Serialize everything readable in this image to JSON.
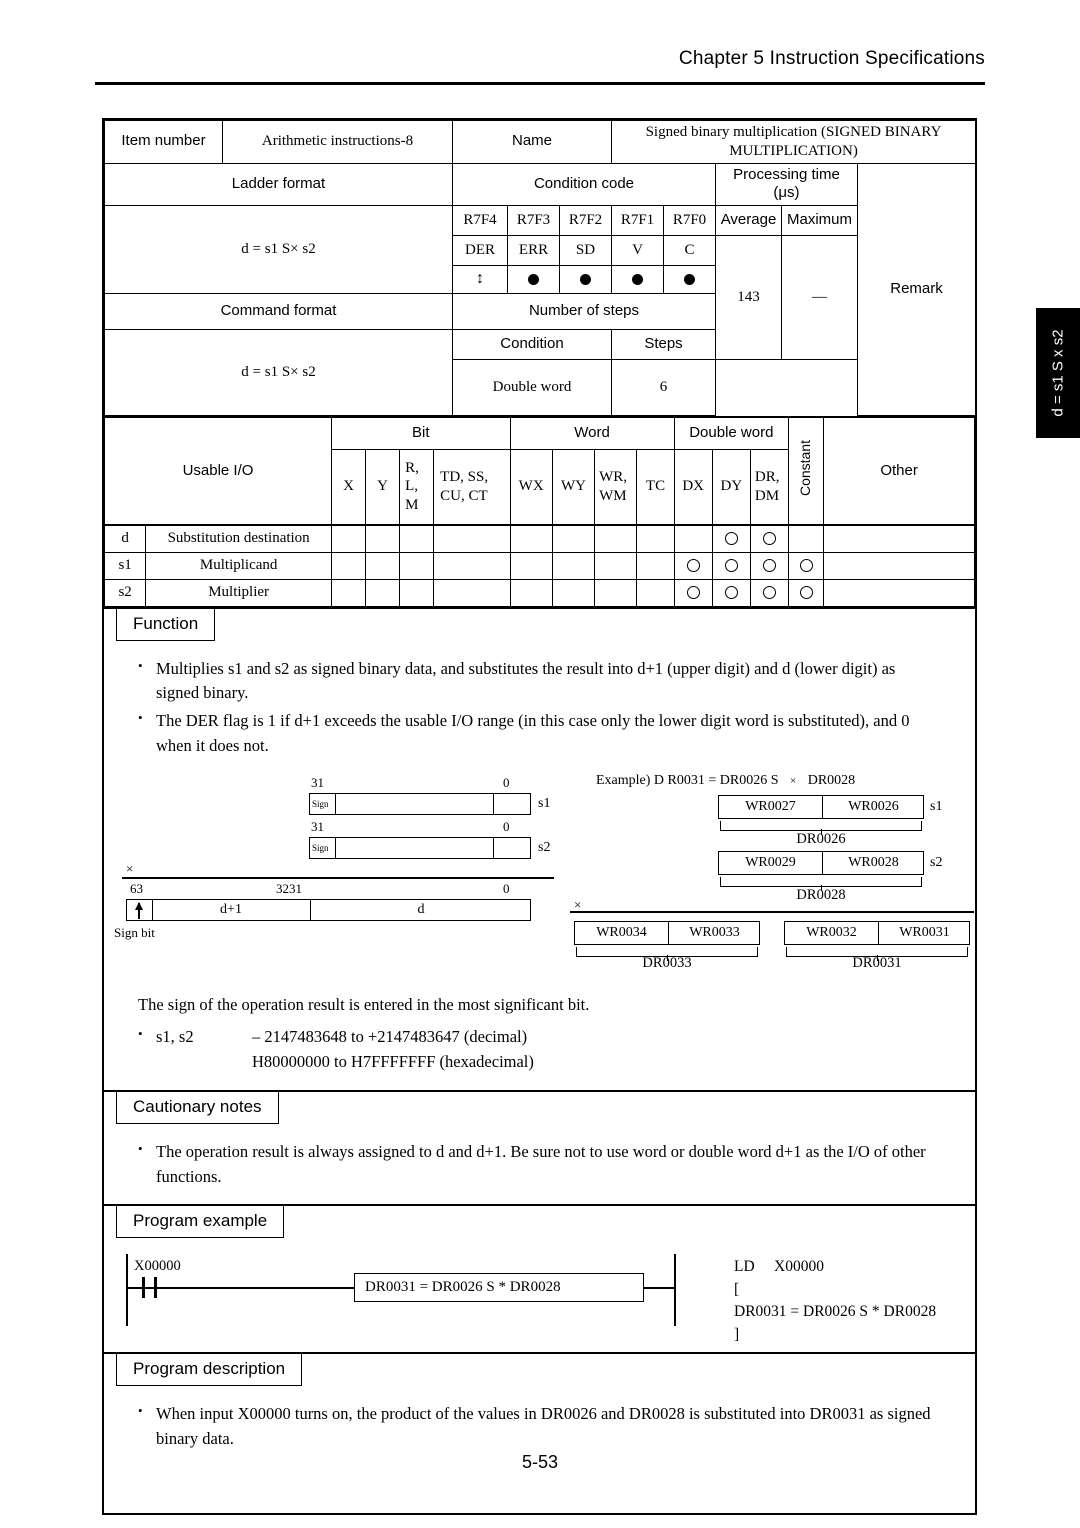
{
  "header": {
    "chapter": "Chapter 5  Instruction Specifications"
  },
  "side_tab": {
    "label": "d = s1 S x s2"
  },
  "footer": {
    "page_number": "5-53"
  },
  "spec_table": {
    "item_number_label": "Item number",
    "item_number_value": "Arithmetic instructions-8",
    "name_label": "Name",
    "name_value": "Signed binary multiplication (SIGNED BINARY MULTIPLICATION)",
    "ladder_format_label": "Ladder format",
    "condition_code_label": "Condition code",
    "processing_time_label": "Processing time (μs)",
    "remark_label": "Remark",
    "ladder_expression": "d = s1 S× s2",
    "flag_bits": [
      "R7F4",
      "R7F3",
      "R7F2",
      "R7F1",
      "R7F0"
    ],
    "flag_names": [
      "DER",
      "ERR",
      "SD",
      "V",
      "C"
    ],
    "flag_marks": [
      "updown",
      "dot",
      "dot",
      "dot",
      "dot"
    ],
    "average_label": "Average",
    "maximum_label": "Maximum",
    "average_value": "143",
    "maximum_value": "—",
    "remark_value": "",
    "command_format_label": "Command format",
    "number_of_steps_label": "Number of steps",
    "condition_label": "Condition",
    "steps_label": "Steps",
    "command_expression": "d = s1 S× s2",
    "condition_value": "Double word",
    "steps_value": "6"
  },
  "usable_io": {
    "title": "Usable I/O",
    "group_headers": [
      "Bit",
      "Word",
      "Double word"
    ],
    "constant_label": "Constant",
    "other_label": "Other",
    "columns": [
      {
        "id": "X",
        "lines": [
          "X"
        ]
      },
      {
        "id": "Y",
        "lines": [
          "Y"
        ]
      },
      {
        "id": "RLM",
        "lines": [
          "R,",
          "L,",
          "M"
        ]
      },
      {
        "id": "TD",
        "lines": [
          "TD, SS,",
          "CU, CT"
        ]
      },
      {
        "id": "WX",
        "lines": [
          "WX"
        ]
      },
      {
        "id": "WY",
        "lines": [
          "WY"
        ]
      },
      {
        "id": "WRWM",
        "lines": [
          "WR,",
          "WM"
        ]
      },
      {
        "id": "TC",
        "lines": [
          "TC"
        ]
      },
      {
        "id": "DX",
        "lines": [
          "DX"
        ]
      },
      {
        "id": "DY",
        "lines": [
          "DY"
        ]
      },
      {
        "id": "DRDM",
        "lines": [
          "DR,",
          "DM"
        ]
      }
    ],
    "rows": [
      {
        "symbol": "d",
        "name": "Substitution destination",
        "marks": [
          false,
          false,
          false,
          false,
          false,
          false,
          false,
          false,
          false,
          true,
          true
        ],
        "constant": false,
        "other": ""
      },
      {
        "symbol": "s1",
        "name": "Multiplicand",
        "marks": [
          false,
          false,
          false,
          false,
          false,
          false,
          false,
          false,
          true,
          true,
          true
        ],
        "constant": true,
        "other": ""
      },
      {
        "symbol": "s2",
        "name": "Multiplier",
        "marks": [
          false,
          false,
          false,
          false,
          false,
          false,
          false,
          false,
          true,
          true,
          true
        ],
        "constant": true,
        "other": ""
      }
    ]
  },
  "function": {
    "label": "Function",
    "bullets": [
      "Multiplies s1 and s2 as signed binary data, and substitutes the result into d+1 (upper digit) and d (lower digit) as signed binary.",
      "The DER flag is 1 if d+1 exceeds the usable I/O range (in this case only the lower digit word is substituted), and 0 when it does not."
    ],
    "sign_note": "The sign of the operation result is entered in the most significant bit.",
    "range": {
      "label": "s1, s2",
      "decimal": "– 2147483648 to +2147483647 (decimal)",
      "hexadecimal": "H80000000 to H7FFFFFFF (hexadecimal)"
    }
  },
  "bit_diagram": {
    "multiply_symbol": "×",
    "sign_text": "Sign",
    "sign_bit_label": "Sign bit",
    "operands": [
      {
        "tag": "s1",
        "high_tick": "31",
        "low_tick": "0"
      },
      {
        "tag": "s2",
        "high_tick": "31",
        "low_tick": "0"
      }
    ],
    "result": {
      "ticks": [
        "63",
        "3231",
        "0"
      ],
      "upper_label": "d+1",
      "lower_label": "d"
    }
  },
  "example_diagram": {
    "caption": "Example) D R0031 = DR0026 S",
    "caption_mult": "×",
    "caption_tail": "DR0028",
    "multiply_symbol": "×",
    "operands": [
      {
        "tag": "s1",
        "words": [
          "WR0027",
          "WR0026"
        ],
        "brace_label": "DR0026"
      },
      {
        "tag": "s2",
        "words": [
          "WR0029",
          "WR0028"
        ],
        "brace_label": "DR0028"
      }
    ],
    "results": [
      {
        "words": [
          "WR0034",
          "WR0033"
        ],
        "brace_label": "DR0033"
      },
      {
        "words": [
          "WR0032",
          "WR0031"
        ],
        "brace_label": "DR0031"
      }
    ]
  },
  "cautionary_notes": {
    "label": "Cautionary notes",
    "bullets": [
      "The operation result is always assigned to d and d+1.  Be sure not to use word or double word d+1 as the I/O of other functions."
    ]
  },
  "program_example": {
    "label": "Program example",
    "input_label": "X00000",
    "function_box": "DR0031 = DR0026 S * DR0028",
    "mnemonic": "LD     X00000\n[\nDR0031 = DR0026 S * DR0028\n]"
  },
  "program_description": {
    "label": "Program description",
    "bullets": [
      "When input X00000 turns on, the product of the values in DR0026 and DR0028 is substituted into DR0031 as signed binary data."
    ]
  }
}
